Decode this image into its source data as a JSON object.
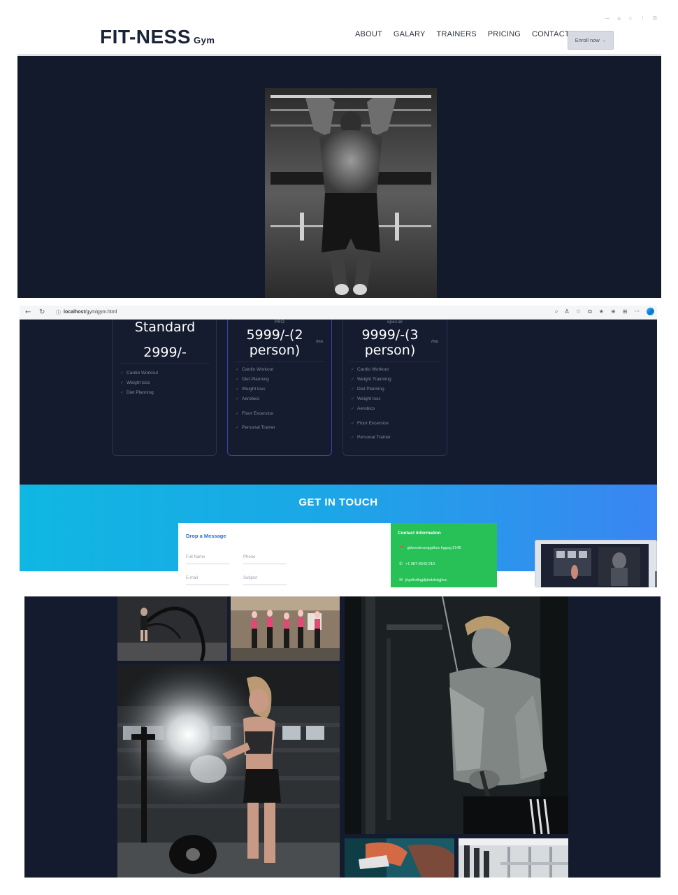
{
  "panel1": {
    "brand": {
      "name": "FIT-NESS",
      "sub": "Gym"
    },
    "nav": [
      "ABOUT",
      "GALARY",
      "TRAINERS",
      "PRICING",
      "CONTACT US"
    ],
    "enroll_label": "Enroll now",
    "enroll_arrow": "→",
    "window_controls": [
      "—",
      "⌂",
      "☆",
      "⋮",
      "⊟"
    ],
    "hero_image": "man doing pull-ups (black and white)"
  },
  "panel2": {
    "browser": {
      "back": "←",
      "reload": "↻",
      "info": "ⓘ",
      "url_host": "localhost",
      "url_path": "/gym/gym.html",
      "tools": [
        "⌕",
        "A",
        "☆",
        "⧉",
        "★",
        "⊕",
        "⊞",
        "···"
      ]
    },
    "plans": [
      {
        "tag": "",
        "price_line1": "Standard",
        "price_line2": "2999/-",
        "per": "",
        "features": [
          "Cardio Workout",
          "Weight loss",
          "Diet Planning"
        ]
      },
      {
        "tag": "PRO",
        "price_line1": "5999/-(2",
        "price_line2": "person)",
        "per": "/mo",
        "features": [
          "Cardio Workout",
          "Diet Planning",
          "Weight loss",
          "Aerobics",
          "Floor Excersice",
          "Personal Trainer"
        ]
      },
      {
        "tag": "special",
        "price_line1": "9999/-(3",
        "price_line2": "person)",
        "per": "/mo",
        "features": [
          "Cardio Workout",
          "Weight Trainning",
          "Diet Planning",
          "Weight loss",
          "Aerobics",
          "Floor Excersice",
          "Personal Trainer"
        ]
      }
    ],
    "touch_title": "GET IN TOUCH",
    "form": {
      "title": "Drop a Message",
      "full_name": "Full Name",
      "phone": "Phone",
      "email": "E-mail",
      "subject": "Subject"
    },
    "contact": {
      "title": "Contact Information",
      "address": "gkkeosknsnggdhsv hggsg 2146",
      "phone": "+1 987-6543-210",
      "email": "jhgdfsdhgjdjdsdshdgjksc",
      "icons": {
        "address": "📍",
        "phone": "✆",
        "email": "✉"
      }
    }
  },
  "panel3": {
    "gallery": [
      "battle ropes workout",
      "group fitness class",
      "woman with chalk and barbell",
      "man using cable machine",
      "running shoes close-up",
      "gym equipment"
    ]
  }
}
